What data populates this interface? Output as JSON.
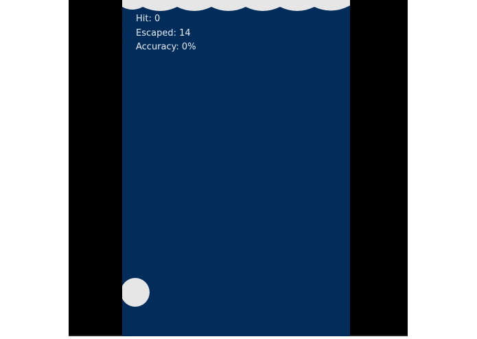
{
  "hud": {
    "hit_label": "Hit: 0",
    "escaped_label": "Escaped: 14",
    "accuracy_label": "Accuracy: 0%"
  },
  "stats": {
    "hit": 0,
    "escaped": 14,
    "accuracy_percent": 0
  },
  "colors": {
    "background": "#000000",
    "water": "#022c5a",
    "foam": "#e6e6e6",
    "hud_text": "#e8ecf2"
  }
}
